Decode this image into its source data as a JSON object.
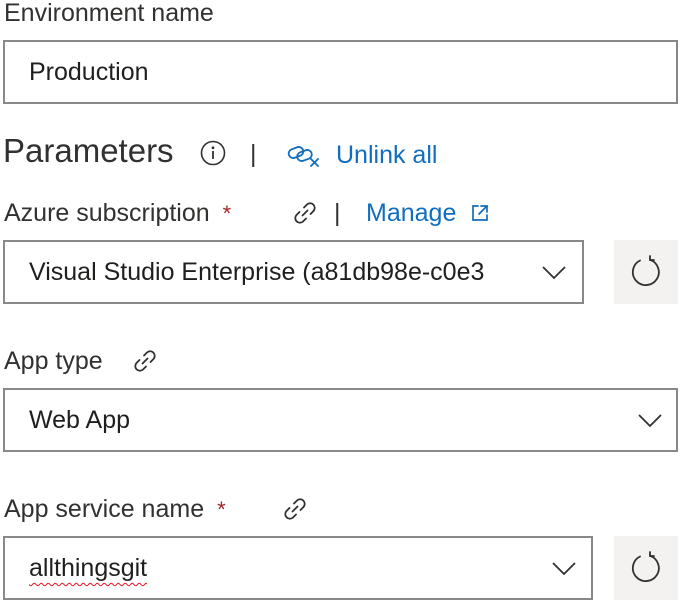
{
  "environment": {
    "label": "Environment name",
    "value": "Production"
  },
  "parameters": {
    "heading": "Parameters",
    "separator": "|",
    "unlink_all_label": "Unlink all"
  },
  "azure_subscription": {
    "label": "Azure subscription",
    "required_mark": "*",
    "separator": "|",
    "manage_label": "Manage",
    "value": "Visual Studio Enterprise (a81db98e-c0e3"
  },
  "app_type": {
    "label": "App type",
    "value": "Web App"
  },
  "app_service_name": {
    "label": "App service name",
    "required_mark": "*",
    "value": "allthingsgit"
  },
  "colors": {
    "link": "#106ebe",
    "required": "#a4262c",
    "border": "#8a8886",
    "button_bg": "#f3f2f1",
    "spellcheck": "#e81123"
  },
  "icons": [
    "info-icon",
    "unlink-icon",
    "link-icon",
    "external-link-icon",
    "chevron-down-icon",
    "refresh-icon"
  ]
}
